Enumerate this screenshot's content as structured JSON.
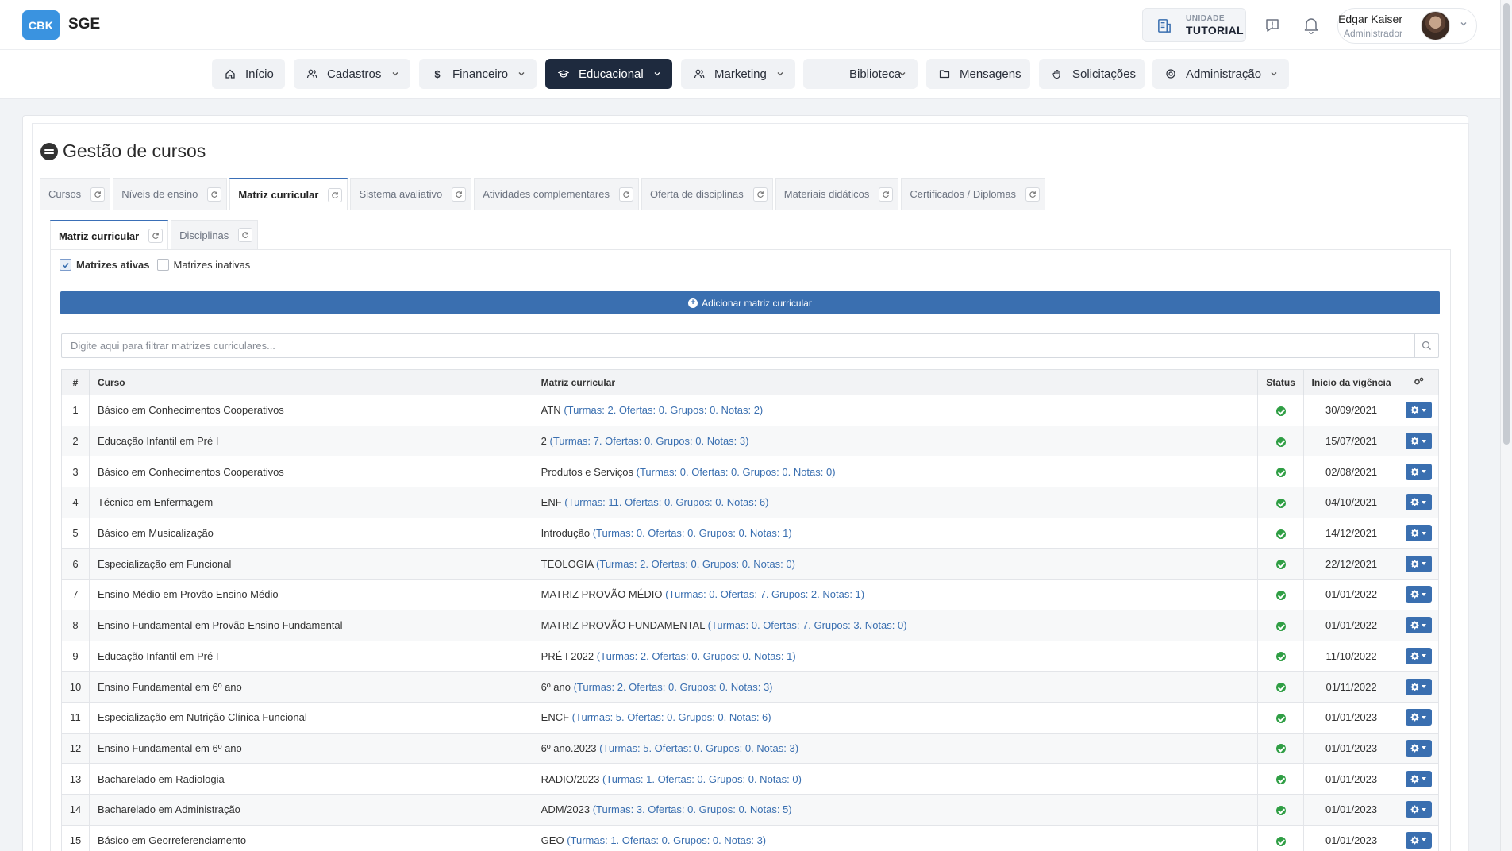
{
  "app": {
    "logo": "CBK",
    "name": "SGE"
  },
  "unit": {
    "label": "UNIDADE",
    "name": "TUTORIAL"
  },
  "user": {
    "name": "Edgar Kaiser",
    "role": "Administrador"
  },
  "nav": [
    {
      "label": "Início",
      "icon": "home-icon",
      "dropdown": false,
      "active": false
    },
    {
      "label": "Cadastros",
      "icon": "users-icon",
      "dropdown": true,
      "active": false
    },
    {
      "label": "Financeiro",
      "icon": "dollar-icon",
      "dropdown": true,
      "active": false
    },
    {
      "label": "Educacional",
      "icon": "graduation-cap-icon",
      "dropdown": true,
      "active": true
    },
    {
      "label": "Marketing",
      "icon": "users-icon",
      "dropdown": true,
      "active": false
    },
    {
      "label": "Biblioteca",
      "icon": "book-icon",
      "dropdown": true,
      "active": false
    },
    {
      "label": "Mensagens",
      "icon": "folder-icon",
      "dropdown": false,
      "active": false
    },
    {
      "label": "Solicitações",
      "icon": "hand-icon",
      "dropdown": false,
      "active": false
    },
    {
      "label": "Administração",
      "icon": "settings-icon",
      "dropdown": true,
      "active": false
    }
  ],
  "page": {
    "title": "Gestão de cursos"
  },
  "tabs": [
    {
      "label": "Cursos",
      "active": false
    },
    {
      "label": "Níveis de ensino",
      "active": false
    },
    {
      "label": "Matriz curricular",
      "active": true
    },
    {
      "label": "Sistema avaliativo",
      "active": false
    },
    {
      "label": "Atividades complementares",
      "active": false
    },
    {
      "label": "Oferta de disciplinas",
      "active": false
    },
    {
      "label": "Materiais didáticos",
      "active": false
    },
    {
      "label": "Certificados / Diplomas",
      "active": false
    }
  ],
  "subtabs": [
    {
      "label": "Matriz curricular",
      "active": true
    },
    {
      "label": "Disciplinas",
      "active": false
    }
  ],
  "filters": {
    "active_label": "Matrizes ativas",
    "active_checked": true,
    "inactive_label": "Matrizes inativas",
    "inactive_checked": false
  },
  "add_button": {
    "label": "Adicionar matriz curricular"
  },
  "search": {
    "placeholder": "Digite aqui para filtrar matrizes curriculares...",
    "value": ""
  },
  "table": {
    "headers": {
      "num": "#",
      "course": "Curso",
      "matrix": "Matriz curricular",
      "status": "Status",
      "start": "Início da vigência"
    },
    "rows": [
      {
        "num": "1",
        "course": "Básico em Conhecimentos Cooperativos",
        "matrix": "ATN",
        "matrix_extra": "(Turmas: 2. Ofertas: 0. Grupos: 0. Notas: 2)",
        "status": "active",
        "start": "30/09/2021"
      },
      {
        "num": "2",
        "course": "Educação Infantil em Pré I",
        "matrix": "2",
        "matrix_extra": "(Turmas: 7. Ofertas: 0. Grupos: 0. Notas: 3)",
        "status": "active",
        "start": "15/07/2021"
      },
      {
        "num": "3",
        "course": "Básico em Conhecimentos Cooperativos",
        "matrix": "Produtos e Serviços",
        "matrix_extra": "(Turmas: 0. Ofertas: 0. Grupos: 0. Notas: 0)",
        "status": "active",
        "start": "02/08/2021"
      },
      {
        "num": "4",
        "course": "Técnico em Enfermagem",
        "matrix": "ENF",
        "matrix_extra": "(Turmas: 11. Ofertas: 0. Grupos: 0. Notas: 6)",
        "status": "active",
        "start": "04/10/2021"
      },
      {
        "num": "5",
        "course": "Básico em Musicalização",
        "matrix": "Introdução",
        "matrix_extra": "(Turmas: 0. Ofertas: 0. Grupos: 0. Notas: 1)",
        "status": "active",
        "start": "14/12/2021"
      },
      {
        "num": "6",
        "course": "Especialização em Funcional",
        "matrix": "TEOLOGIA",
        "matrix_extra": "(Turmas: 2. Ofertas: 0. Grupos: 0. Notas: 0)",
        "status": "active",
        "start": "22/12/2021"
      },
      {
        "num": "7",
        "course": "Ensino Médio em Provão Ensino Médio",
        "matrix": "MATRIZ PROVÃO MÉDIO",
        "matrix_extra": "(Turmas: 0. Ofertas: 7. Grupos: 2. Notas: 1)",
        "status": "active",
        "start": "01/01/2022"
      },
      {
        "num": "8",
        "course": "Ensino Fundamental em Provão Ensino Fundamental",
        "matrix": "MATRIZ PROVÃO FUNDAMENTAL",
        "matrix_extra": "(Turmas: 0. Ofertas: 7. Grupos: 3. Notas: 0)",
        "status": "active",
        "start": "01/01/2022"
      },
      {
        "num": "9",
        "course": "Educação Infantil em Pré I",
        "matrix": "PRÉ I 2022",
        "matrix_extra": "(Turmas: 2. Ofertas: 0. Grupos: 0. Notas: 1)",
        "status": "active",
        "start": "11/10/2022"
      },
      {
        "num": "10",
        "course": "Ensino Fundamental em 6º ano",
        "matrix": "6º ano",
        "matrix_extra": "(Turmas: 2. Ofertas: 0. Grupos: 0. Notas: 3)",
        "status": "active",
        "start": "01/11/2022"
      },
      {
        "num": "11",
        "course": "Especialização em Nutrição Clínica Funcional",
        "matrix": "ENCF",
        "matrix_extra": "(Turmas: 5. Ofertas: 0. Grupos: 0. Notas: 6)",
        "status": "active",
        "start": "01/01/2023"
      },
      {
        "num": "12",
        "course": "Ensino Fundamental em 6º ano",
        "matrix": "6º ano.2023",
        "matrix_extra": "(Turmas: 5. Ofertas: 0. Grupos: 0. Notas: 3)",
        "status": "active",
        "start": "01/01/2023"
      },
      {
        "num": "13",
        "course": "Bacharelado em Radiologia",
        "matrix": "RADIO/2023",
        "matrix_extra": "(Turmas: 1. Ofertas: 0. Grupos: 0. Notas: 0)",
        "status": "active",
        "start": "01/01/2023"
      },
      {
        "num": "14",
        "course": "Bacharelado em Administração",
        "matrix": "ADM/2023",
        "matrix_extra": "(Turmas: 3. Ofertas: 0. Grupos: 0. Notas: 5)",
        "status": "active",
        "start": "01/01/2023"
      },
      {
        "num": "15",
        "course": "Básico em Georreferenciamento",
        "matrix": "GEO",
        "matrix_extra": "(Turmas: 1. Ofertas: 0. Grupos: 0. Notas: 3)",
        "status": "active",
        "start": "01/01/2023"
      }
    ]
  },
  "colors": {
    "brand": "#3a93e0",
    "nav_active": "#1e2a3e",
    "primary": "#3a6fb0",
    "status_active": "#2f9e44"
  }
}
